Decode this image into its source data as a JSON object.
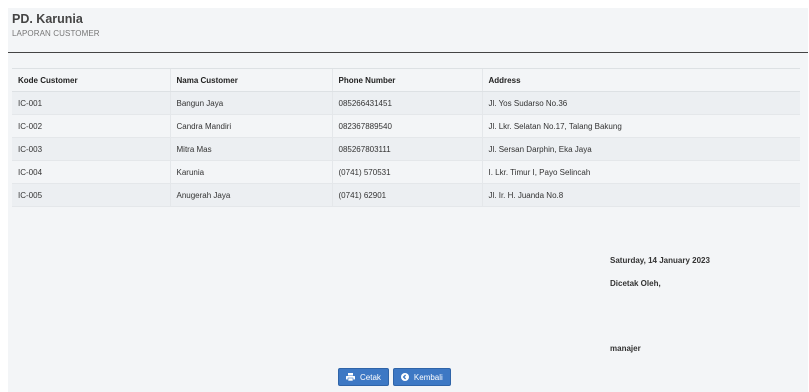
{
  "header": {
    "company": "PD. Karunia",
    "subtitle": "LAPORAN CUSTOMER"
  },
  "table": {
    "columns": [
      "Kode Customer",
      "Nama Customer",
      "Phone Number",
      "Address"
    ],
    "rows": [
      [
        "IC-001",
        "Bangun Jaya",
        "085266431451",
        "Jl. Yos Sudarso No.36"
      ],
      [
        "IC-002",
        "Candra Mandiri",
        "082367889540",
        "Jl. Lkr. Selatan No.17, Talang Bakung"
      ],
      [
        "IC-003",
        "Mitra Mas",
        "085267803111",
        "Jl. Sersan Darphin, Eka Jaya"
      ],
      [
        "IC-004",
        "Karunia",
        "(0741) 570531",
        "I. Lkr. Timur I, Payo Selincah"
      ],
      [
        "IC-005",
        "Anugerah Jaya",
        "(0741) 62901",
        "Jl. Ir. H. Juanda No.8"
      ]
    ]
  },
  "signature": {
    "date": "Saturday, 14 January 2023",
    "printed_by": "Dicetak Oleh,",
    "name": "manajer"
  },
  "actions": {
    "print_label": "Cetak",
    "print_icon": "print-icon",
    "back_label": "Kembali",
    "back_icon": "arrow-left-circle-icon"
  },
  "colors": {
    "button": "#3d78c4",
    "background": "#f3f5f7"
  }
}
